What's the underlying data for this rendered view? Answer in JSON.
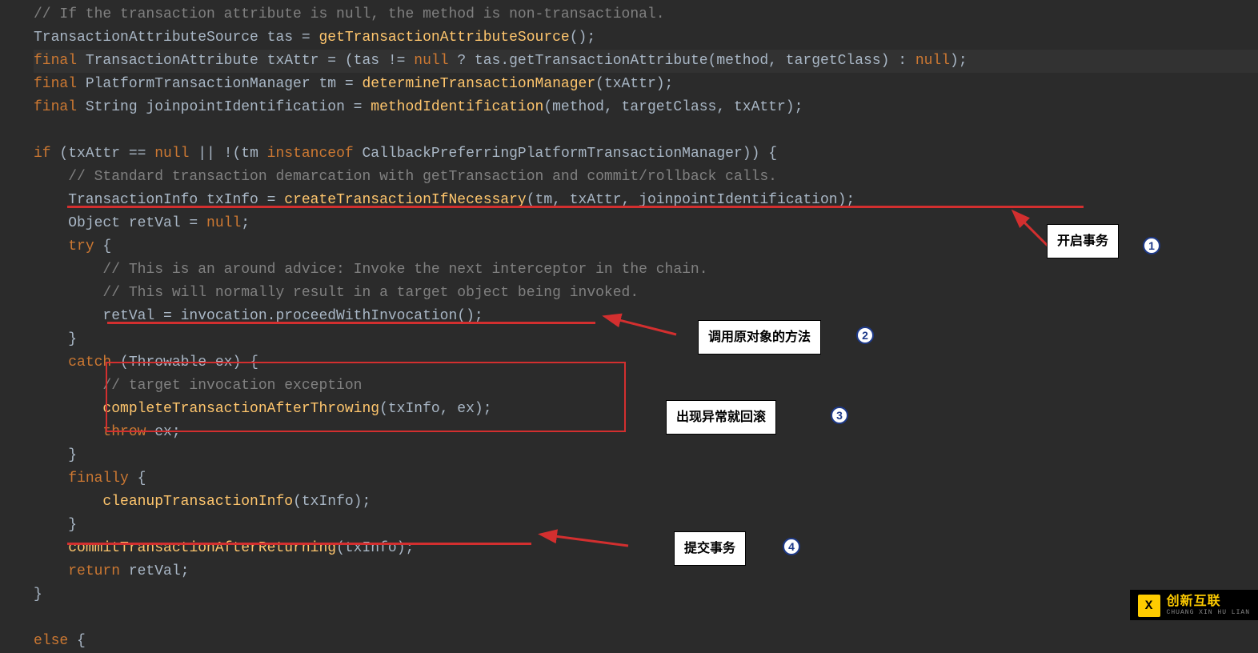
{
  "code": {
    "l1_comment": "// If the transaction attribute is null, the method is non-transactional.",
    "l2_a": "TransactionAttributeSource tas = ",
    "l2_b": "getTransactionAttributeSource",
    "l2_c": "();",
    "l3_a": "final",
    "l3_b": " TransactionAttribute txAttr = (tas != ",
    "l3_c": "null",
    "l3_d": " ? tas.getTransactionAttribute(method, targetClass) : ",
    "l3_e": "null",
    "l3_f": ");",
    "l4_a": "final",
    "l4_b": " PlatformTransactionManager tm = ",
    "l4_c": "determineTransactionManager",
    "l4_d": "(txAttr);",
    "l5_a": "final",
    "l5_b": " String joinpointIdentification = ",
    "l5_c": "methodIdentification",
    "l5_d": "(method, targetClass, txAttr);",
    "l7_a": "if",
    "l7_b": " (txAttr == ",
    "l7_c": "null",
    "l7_d": " || !(tm ",
    "l7_e": "instanceof",
    "l7_f": " CallbackPreferringPlatformTransactionManager)) {",
    "l8_comment": "    // Standard transaction demarcation with getTransaction and commit/rollback calls.",
    "l9_a": "    TransactionInfo txInfo = ",
    "l9_b": "createTransactionIfNecessary",
    "l9_c": "(tm, txAttr, joinpointIdentification);",
    "l10_a": "    Object retVal = ",
    "l10_b": "null",
    "l10_c": ";",
    "l11_a": "    ",
    "l11_b": "try",
    "l11_c": " {",
    "l12_comment": "        // This is an around advice: Invoke the next interceptor in the chain.",
    "l13_comment": "        // This will normally result in a target object being invoked.",
    "l14_a": "        retVal = invocation.proceedWithInvocation();",
    "l15": "    }",
    "l16_a": "    ",
    "l16_b": "catch",
    "l16_c": " (Throwable ex) {",
    "l17_comment": "        // target invocation exception",
    "l18_a": "        ",
    "l18_b": "completeTransactionAfterThrowing",
    "l18_c": "(txInfo, ex);",
    "l19_a": "        ",
    "l19_b": "throw",
    "l19_c": " ex;",
    "l20": "    }",
    "l21_a": "    ",
    "l21_b": "finally",
    "l21_c": " {",
    "l22_a": "        ",
    "l22_b": "cleanupTransactionInfo",
    "l22_c": "(txInfo);",
    "l23": "    }",
    "l24_a": "    ",
    "l24_b": "commitTransactionAfterReturning",
    "l24_c": "(txInfo);",
    "l25_a": "    ",
    "l25_b": "return",
    "l25_c": " retVal;",
    "l26": "}",
    "l28_a": "else",
    "l28_b": " {"
  },
  "annotations": {
    "label1": "开启事务",
    "label2": "调用原对象的方法",
    "label3": "出现异常就回滚",
    "label4": "提交事务",
    "num1": "1",
    "num2": "2",
    "num3": "3",
    "num4": "4"
  },
  "watermark": {
    "logo": "X",
    "title": "创新互联",
    "sub": "CHUANG XIN HU LIAN"
  }
}
